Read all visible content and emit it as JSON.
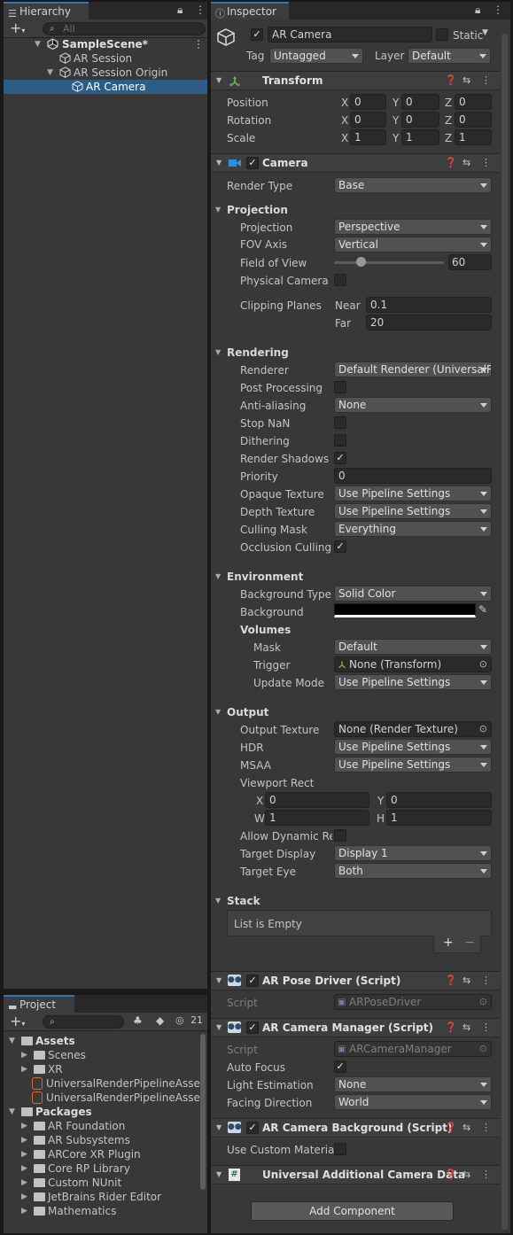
{
  "hierarchy": {
    "tab_label": "Hierarchy",
    "search_placeholder": "All",
    "items": [
      {
        "label": "SampleScene*"
      },
      {
        "label": "AR Session"
      },
      {
        "label": "AR Session Origin"
      },
      {
        "label": "AR Camera"
      }
    ]
  },
  "project": {
    "tab_label": "Project",
    "hidden_count": "21",
    "tree": [
      {
        "label": "Assets"
      },
      {
        "label": "Scenes"
      },
      {
        "label": "XR"
      },
      {
        "label": "UniversalRenderPipelineAsset"
      },
      {
        "label": "UniversalRenderPipelineAsset"
      },
      {
        "label": "Packages"
      },
      {
        "label": "AR Foundation"
      },
      {
        "label": "AR Subsystems"
      },
      {
        "label": "ARCore XR Plugin"
      },
      {
        "label": "Core RP Library"
      },
      {
        "label": "Custom NUnit"
      },
      {
        "label": "JetBrains Rider Editor"
      },
      {
        "label": "Mathematics"
      }
    ]
  },
  "inspector": {
    "tab_label": "Inspector",
    "object_name": "AR Camera",
    "static_label": "Static",
    "tag_label": "Tag",
    "tag_value": "Untagged",
    "layer_label": "Layer",
    "layer_value": "Default",
    "transform": {
      "title": "Transform",
      "rows": [
        {
          "label": "Position",
          "x": "0",
          "y": "0",
          "z": "0"
        },
        {
          "label": "Rotation",
          "x": "0",
          "y": "0",
          "z": "0"
        },
        {
          "label": "Scale",
          "x": "1",
          "y": "1",
          "z": "1"
        }
      ],
      "axis_x": "X",
      "axis_y": "Y",
      "axis_z": "Z"
    },
    "camera": {
      "title": "Camera",
      "render_type_label": "Render Type",
      "render_type": "Base",
      "projection_header": "Projection",
      "projection_label": "Projection",
      "projection": "Perspective",
      "fov_axis_label": "FOV Axis",
      "fov_axis": "Vertical",
      "fov_label": "Field of View",
      "fov_value": "60",
      "fov_fraction": 0.24,
      "physical_label": "Physical Camera",
      "clipping_label": "Clipping Planes",
      "near_label": "Near",
      "near": "0.1",
      "far_label": "Far",
      "far": "20",
      "rendering_header": "Rendering",
      "renderer_label": "Renderer",
      "renderer": "Default Renderer (UniversalRenderPipelineAsset_Renderer)",
      "post_label": "Post Processing",
      "aa_label": "Anti-aliasing",
      "aa": "None",
      "stopnan_label": "Stop NaN",
      "dither_label": "Dithering",
      "shadows_label": "Render Shadows",
      "priority_label": "Priority",
      "priority": "0",
      "opaque_label": "Opaque Texture",
      "opaque": "Use Pipeline Settings",
      "depth_label": "Depth Texture",
      "depth": "Use Pipeline Settings",
      "culling_label": "Culling Mask",
      "culling": "Everything",
      "occlusion_label": "Occlusion Culling",
      "environment_header": "Environment",
      "bgtype_label": "Background Type",
      "bgtype": "Solid Color",
      "bg_label": "Background",
      "bg_color": "#000000",
      "volumes_label": "Volumes",
      "mask_label": "Mask",
      "mask": "Default",
      "trigger_label": "Trigger",
      "trigger": "None (Transform)",
      "update_label": "Update Mode",
      "update": "Use Pipeline Settings",
      "output_header": "Output",
      "outtex_label": "Output Texture",
      "outtex": "None (Render Texture)",
      "hdr_label": "HDR",
      "hdr": "Use Pipeline Settings",
      "msaa_label": "MSAA",
      "msaa": "Use Pipeline Settings",
      "viewport_label": "Viewport Rect",
      "vx_label": "X",
      "vx": "0",
      "vy_label": "Y",
      "vy": "0",
      "vw_label": "W",
      "vw": "1",
      "vh_label": "H",
      "vh": "1",
      "dynres_label": "Allow Dynamic Resolution",
      "tdisplay_label": "Target Display",
      "tdisplay": "Display 1",
      "teye_label": "Target Eye",
      "teye": "Both",
      "stack_header": "Stack",
      "stack_empty": "List is Empty",
      "stack_add": "+",
      "stack_remove": "−"
    },
    "pose_driver": {
      "title": "AR Pose Driver (Script)",
      "script_label": "Script",
      "script": "ARPoseDriver"
    },
    "camera_manager": {
      "title": "AR Camera Manager (Script)",
      "script_label": "Script",
      "script": "ARCameraManager",
      "autofocus_label": "Auto Focus",
      "light_label": "Light Estimation",
      "light": "None",
      "facing_label": "Facing Direction",
      "facing": "World"
    },
    "camera_background": {
      "title": "AR Camera Background (Script)",
      "custom_label": "Use Custom Material"
    },
    "additional": {
      "title": "Universal Additional Camera Data"
    },
    "add_component": "Add Component"
  },
  "colors": {
    "selection": "#2c5d87",
    "tab_accent": "#3a72b0",
    "panel": "#383838"
  }
}
